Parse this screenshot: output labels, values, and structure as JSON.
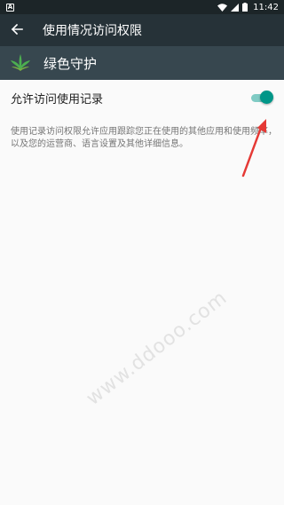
{
  "status_bar": {
    "notification_icon": "A",
    "time": "11:42",
    "icons": [
      "wifi-icon",
      "signal-icon",
      "battery-icon"
    ]
  },
  "app_bar": {
    "title": "使用情况访问权限",
    "back_icon": "arrow-left-icon"
  },
  "app_header": {
    "name": "绿色守护",
    "icon": "leaf-icon"
  },
  "setting": {
    "label": "允许访问使用记录",
    "toggle_on": true
  },
  "description": "使用记录访问权限允许应用跟踪您正在使用的其他应用和使用频率，以及您的运营商、语言设置及其他详细信息。",
  "watermark": "www.ddooo.com",
  "colors": {
    "status_bar": "#1c2528",
    "app_bar": "#263238",
    "app_header": "#37474f",
    "toggle_thumb": "#009688",
    "toggle_track": "#80cbc4",
    "arrow": "#e53935"
  }
}
